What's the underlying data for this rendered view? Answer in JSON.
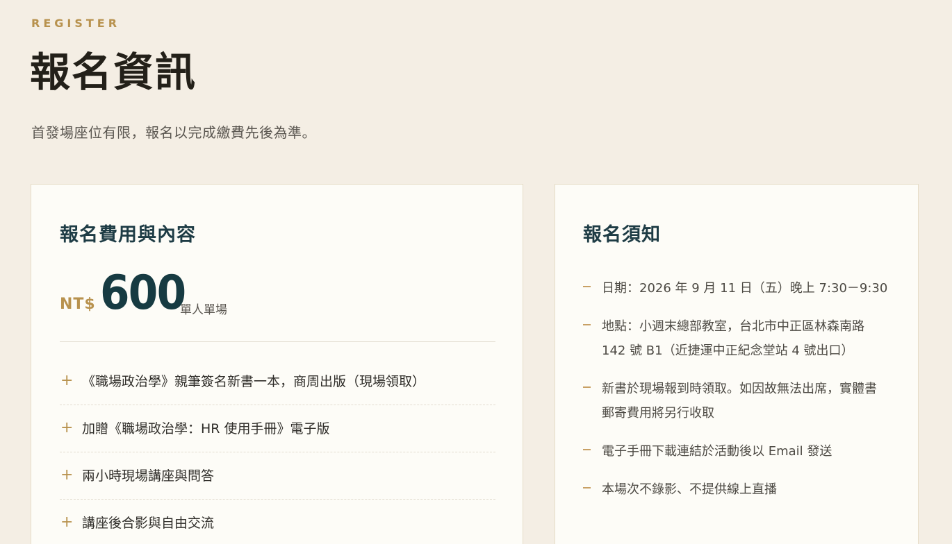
{
  "header": {
    "eyebrow": "REGISTER",
    "title": "報名資訊",
    "subtitle": "首發場座位有限，報名以完成繳費先後為準。"
  },
  "fee_card": {
    "title": "報名費用與內容",
    "currency": "NT$",
    "amount": "600",
    "unit": "單人單場",
    "items": [
      {
        "icon": "plus-icon",
        "label": "《職場政治學》親筆簽名新書一本，商周出版（現場領取）"
      },
      {
        "icon": "plus-icon",
        "label": "加贈《職場政治學：HR 使用手冊》電子版"
      },
      {
        "icon": "plus-icon",
        "label": "兩小時現場講座與問答"
      },
      {
        "icon": "plus-icon",
        "label": "講座後合影與自由交流"
      }
    ]
  },
  "notice_card": {
    "title": "報名須知",
    "notes": [
      {
        "icon": "dash-icon",
        "text": "日期：2026 年 9 月 11 日（五）晚上 7:30－9:30"
      },
      {
        "icon": "dash-icon",
        "text": "地點：小週末總部教室，台北市中正區林森南路 142 號 B1（近捷運中正紀念堂站 4 號出口）"
      },
      {
        "icon": "dash-icon",
        "text": "新書於現場報到時領取。如因故無法出席，實體書郵寄費用將另行收取"
      },
      {
        "icon": "dash-icon",
        "text": "電子手冊下載連結於活動後以 Email 發送"
      },
      {
        "icon": "dash-icon",
        "text": "本場次不錄影、不提供線上直播"
      }
    ]
  },
  "colors": {
    "background": "#f4eee4",
    "card": "#fdfcf7",
    "accent_gold": "#b8924e",
    "heading_teal": "#1e3c45"
  }
}
